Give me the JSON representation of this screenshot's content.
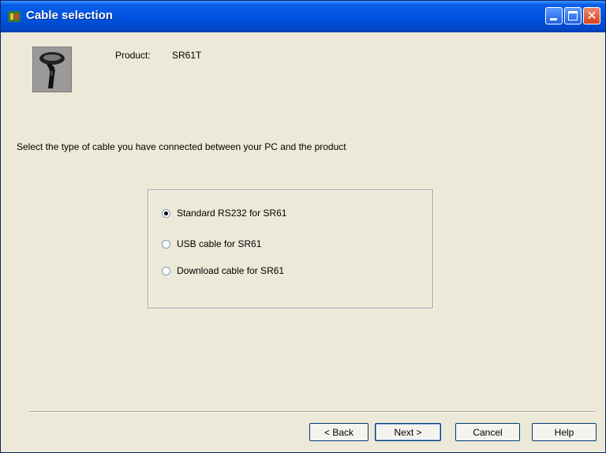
{
  "window": {
    "title": "Cable selection"
  },
  "product": {
    "label": "Product:",
    "value": "SR61T",
    "image": "barcode-scanner-icon"
  },
  "instruction": "Select the type of cable you have connected between your PC and the product",
  "cable_options": [
    {
      "label": "Standard RS232 for SR61",
      "selected": true
    },
    {
      "label": "USB cable for SR61",
      "selected": false
    },
    {
      "label": "Download cable for SR61",
      "selected": false
    }
  ],
  "buttons": {
    "back": "< Back",
    "next": "Next >",
    "cancel": "Cancel",
    "help": "Help"
  },
  "colors": {
    "titlebar": "#0054e3",
    "dialog_bg": "#ece9d8",
    "close_button": "#e0532a"
  }
}
